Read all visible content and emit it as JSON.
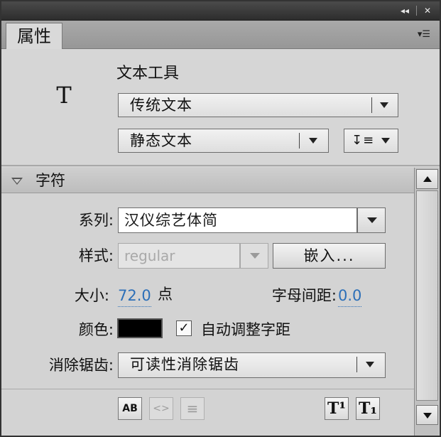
{
  "window_controls": {
    "collapse": "◂◂",
    "close": "✕"
  },
  "tab": {
    "label": "属性"
  },
  "panel_menu_icon": "panel-menu-icon",
  "tool": {
    "icon_glyph": "T",
    "title": "文本工具"
  },
  "text_engine": {
    "selected": "传统文本"
  },
  "text_type": {
    "selected": "静态文本"
  },
  "orientation": {
    "icon_glyph": "↧≡"
  },
  "character": {
    "section_label": "字符",
    "family_label": "系列:",
    "family_value": "汉仪综艺体简",
    "style_label": "样式:",
    "style_value": "regular",
    "embed_button": "嵌入...",
    "size_label": "大小:",
    "size_value": "72.0",
    "size_unit": "点",
    "letter_spacing_label": "字母间距:",
    "letter_spacing_value": "0.0",
    "color_label": "颜色:",
    "color_value": "#000000",
    "auto_kern_label": "自动调整字距",
    "auto_kern_checked": true,
    "anti_alias_label": "消除锯齿:",
    "anti_alias_value": "可读性消除锯齿"
  },
  "bottom_tools": {
    "selectable": "AB",
    "html": "<>",
    "border": "≡",
    "superscript": "T¹",
    "subscript": "T₁"
  }
}
